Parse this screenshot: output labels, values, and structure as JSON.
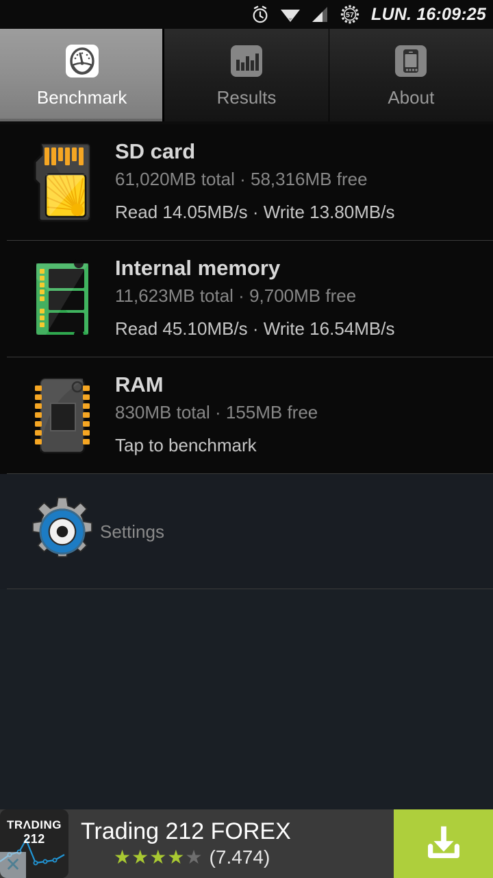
{
  "statusbar": {
    "time": "LUN. 16:09:25",
    "battery_percent": "57",
    "icons": [
      "alarm-clock-icon",
      "wifi-icon",
      "signal-icon",
      "battery-icon"
    ]
  },
  "tabs": [
    {
      "label": "Benchmark",
      "icon": "speedometer-icon",
      "active": true
    },
    {
      "label": "Results",
      "icon": "bar-chart-icon",
      "active": false
    },
    {
      "label": "About",
      "icon": "phone-icon",
      "active": false
    }
  ],
  "list": [
    {
      "title": "SD card",
      "icon": "sd-card-icon",
      "capacity": "61,020MB total · 58,316MB free",
      "speed": "Read 14.05MB/s · Write 13.80MB/s",
      "total_mb": 61020,
      "free_mb": 58316,
      "read_mbs": "14.05",
      "write_mbs": "13.80"
    },
    {
      "title": "Internal memory",
      "icon": "memory-module-icon",
      "capacity": "11,623MB total · 9,700MB free",
      "speed": "Read 45.10MB/s · Write 16.54MB/s",
      "total_mb": 11623,
      "free_mb": 9700,
      "read_mbs": "45.10",
      "write_mbs": "16.54"
    },
    {
      "title": "RAM",
      "icon": "ram-chip-icon",
      "capacity": "830MB total · 155MB free",
      "speed": "Tap to benchmark",
      "total_mb": 830,
      "free_mb": 155,
      "read_mbs": null,
      "write_mbs": null
    }
  ],
  "settings": {
    "label": "Settings",
    "icon": "gear-icon"
  },
  "ad": {
    "title": "Trading 212 FOREX",
    "logo_line1": "TRΛDING",
    "logo_line2": "212",
    "rating": 4,
    "rating_max": 5,
    "reviews": "(7.474)",
    "close_label": "✕",
    "cta_icon": "download-icon"
  },
  "colors": {
    "page_background": "#1a1f25",
    "list_background": "#0a0a0a",
    "active_tab": "#9d9d9d",
    "ad_cta_green": "#aecf3c",
    "star_on": "#a9c932",
    "divider": "#3b3b3b"
  }
}
